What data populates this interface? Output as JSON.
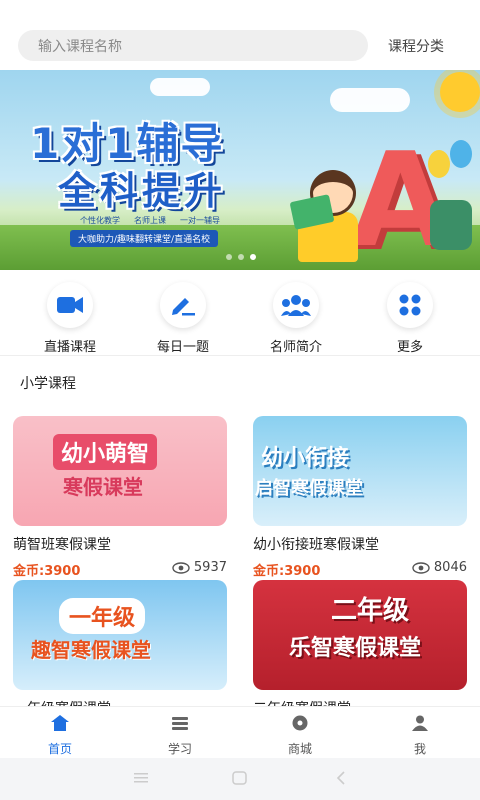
{
  "header": {
    "search_placeholder": "输入课程名称",
    "category_label": "课程分类"
  },
  "banner": {
    "title_line1": "1对1辅导",
    "title_line2": "全科提升",
    "tags": [
      "个性化教学",
      "名师上课",
      "一对一辅导"
    ],
    "slogan": "大咖助力/趣味翻转课堂/直通名校",
    "dots_total": 3,
    "dots_active": 2
  },
  "quick_nav": [
    {
      "label": "直播课程",
      "icon": "video-camera-icon"
    },
    {
      "label": "每日一题",
      "icon": "pencil-icon"
    },
    {
      "label": "名师简介",
      "icon": "teachers-group-icon"
    },
    {
      "label": "更多",
      "icon": "four-dots-icon"
    }
  ],
  "section": {
    "title": "小学课程"
  },
  "courses": [
    {
      "title": "萌智班寒假课堂",
      "price": "金币:3900",
      "views": "5937",
      "img_line1": "幼小萌智",
      "img_line2": "寒假课堂"
    },
    {
      "title": "幼小衔接班寒假课堂",
      "price": "金币:3900",
      "views": "8046",
      "img_line1": "幼小衔接",
      "img_line2": "启智寒假课堂"
    },
    {
      "title": "一年级寒假课堂",
      "price": "",
      "views": "",
      "img_line1": "一年级",
      "img_line2": "趣智寒假课堂"
    },
    {
      "title": "二年级寒假课堂",
      "price": "",
      "views": "",
      "img_line1": "二年级",
      "img_line2": "乐智寒假课堂"
    }
  ],
  "tabbar": [
    {
      "label": "首页",
      "icon": "home-icon",
      "active": true
    },
    {
      "label": "学习",
      "icon": "study-icon",
      "active": false
    },
    {
      "label": "商城",
      "icon": "shop-icon",
      "active": false
    },
    {
      "label": "我",
      "icon": "profile-icon",
      "active": false
    }
  ],
  "colors": {
    "accent": "#1e6fe0",
    "price": "#e8531f"
  }
}
